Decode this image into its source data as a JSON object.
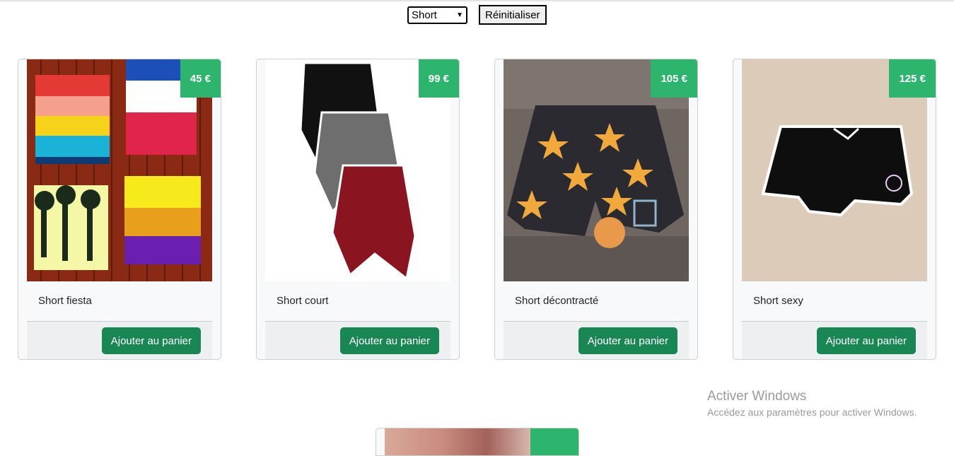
{
  "filter": {
    "selected": "Short",
    "reset_label": "Réinitialiser"
  },
  "products": [
    {
      "name": "Short fiesta",
      "price": "45 €",
      "button": "Ajouter au panier"
    },
    {
      "name": "Short court",
      "price": "99 €",
      "button": "Ajouter au panier"
    },
    {
      "name": "Short décontracté",
      "price": "105 €",
      "button": "Ajouter au panier"
    },
    {
      "name": "Short sexy",
      "price": "125 €",
      "button": "Ajouter au panier"
    }
  ],
  "watermark": {
    "title": "Activer Windows",
    "subtitle": "Accédez aux paramètres pour activer Windows."
  },
  "colors": {
    "price_badge": "#2eb56d",
    "button": "#198754"
  }
}
